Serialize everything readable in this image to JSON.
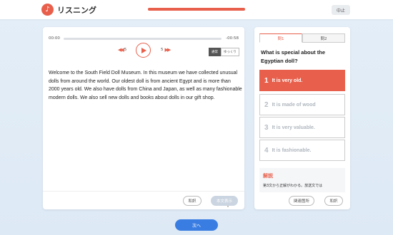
{
  "header": {
    "title": "リスニング",
    "stop_label": "中止",
    "progress": 1.0,
    "colors": {
      "accent": "#e8604c",
      "progress_track": "#f3c7be"
    }
  },
  "player": {
    "time_start": "00:00",
    "time_end": "-00:58",
    "rewind_seconds": "5",
    "forward_seconds": "5",
    "speed_normal": "通常",
    "speed_slow": "ゆっくり"
  },
  "passage": {
    "text": "Welcome to the South Field Doll Museum. In this museum we have collected unusual dolls from around the world. Our oldest doll is from ancient Egypt and is more than 2000 years old. We also have dolls from China and Japan, as well as many fashionable modern dolls. We also sell new dolls and books about dolls in our gift shop."
  },
  "left_footer": {
    "translation_label": "和訳",
    "show_text_label": "本文表示"
  },
  "question_panel": {
    "tabs": [
      {
        "label": "問1"
      },
      {
        "label": "問2"
      }
    ],
    "question": "What is special about the Egyptian doll?",
    "options": [
      {
        "number": "1",
        "text": "It is very old."
      },
      {
        "number": "2",
        "text": "It is made of wood"
      },
      {
        "number": "3",
        "text": "It is very valuable."
      },
      {
        "number": "4",
        "text": "It is fashionable."
      }
    ],
    "selected_index": 0,
    "explanation_title": "解説",
    "explanation_text": "第3文から正解がわかる。放送文では",
    "related_label": "関連箇所",
    "translation_label": "和訳"
  },
  "footer": {
    "next_label": "次へ",
    "colors": {
      "next_button": "#3a7de2"
    }
  }
}
